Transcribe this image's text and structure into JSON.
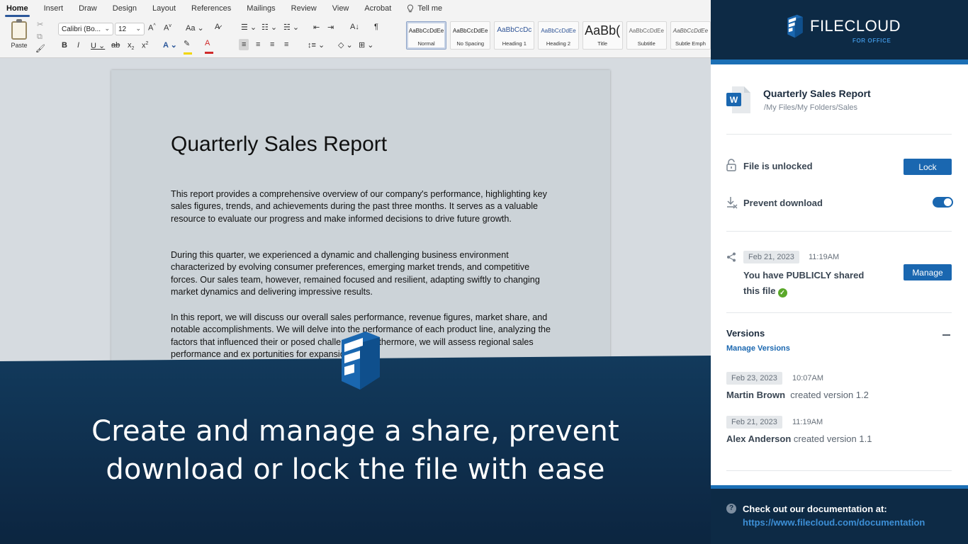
{
  "word": {
    "tabs": [
      "Home",
      "Insert",
      "Draw",
      "Design",
      "Layout",
      "References",
      "Mailings",
      "Review",
      "View",
      "Acrobat"
    ],
    "active_tab": "Home",
    "tell_me": "Tell me",
    "paste_label": "Paste",
    "font_name": "Calibri (Bo...",
    "font_size": "12",
    "styles": [
      {
        "preview": "AaBbCcDdEe",
        "name": "Normal"
      },
      {
        "preview": "AaBbCcDdEe",
        "name": "No Spacing"
      },
      {
        "preview": "AaBbCcDc",
        "name": "Heading 1"
      },
      {
        "preview": "AaBbCcDdEe",
        "name": "Heading 2"
      },
      {
        "preview": "AaBb(",
        "name": "Title"
      },
      {
        "preview": "AaBbCcDdEe",
        "name": "Subtitle"
      },
      {
        "preview": "AaBbCcDdEe",
        "name": "Subtle Emph"
      }
    ]
  },
  "document": {
    "title": "Quarterly Sales Report",
    "paragraphs": [
      "This report provides a comprehensive overview of our company's performance, highlighting key sales figures, trends, and achievements during the past three months. It serves as a valuable resource to evaluate our progress and make informed decisions to drive future growth.",
      "During this quarter, we experienced a dynamic and challenging business environment characterized by evolving consumer preferences, emerging market trends, and competitive forces. Our sales team, however, remained focused and resilient, adapting swiftly to changing market dynamics and delivering impressive results.",
      "In this report, we will discuss our overall sales performance, revenue figures, market share, and notable accomplishments. We will delve into the performance of each product line, analyzing the factors that influenced their or posed challenges. Furthermore, we will assess regional sales performance and ex portunities for expansion and"
    ]
  },
  "banner": {
    "headline_line1": "Create and manage a share, prevent",
    "headline_line2": "download or lock the file with ease"
  },
  "panel": {
    "brand": "FILECLOUD",
    "brand_sub": "FOR OFFICE",
    "file": {
      "title": "Quarterly Sales Report",
      "path": "/My Files/My Folders/Sales",
      "icon_letter": "W"
    },
    "lock": {
      "status": "File is unlocked",
      "button": "Lock"
    },
    "prevent_download": {
      "label": "Prevent download",
      "enabled": true
    },
    "share": {
      "date": "Feb 21, 2023",
      "time": "11:19AM",
      "text_line1": "You have PUBLICLY shared",
      "text_line2": "this file",
      "button": "Manage"
    },
    "versions": {
      "heading": "Versions",
      "manage_link": "Manage Versions",
      "items": [
        {
          "date": "Feb 23, 2023",
          "time": "10:07AM",
          "user": "Martin Brown",
          "action": "created version 1.2"
        },
        {
          "date": "Feb 21, 2023",
          "time": "11:19AM",
          "user": "Alex Anderson",
          "action": "created version 1.1"
        }
      ]
    },
    "footer": {
      "text": "Check out our documentation at:",
      "url": "https://www.filecloud.com/documentation"
    },
    "colors": {
      "navy": "#0d2a45",
      "accent": "#1b6fb5",
      "button": "#1a67b0",
      "success": "#5aa82a"
    }
  }
}
